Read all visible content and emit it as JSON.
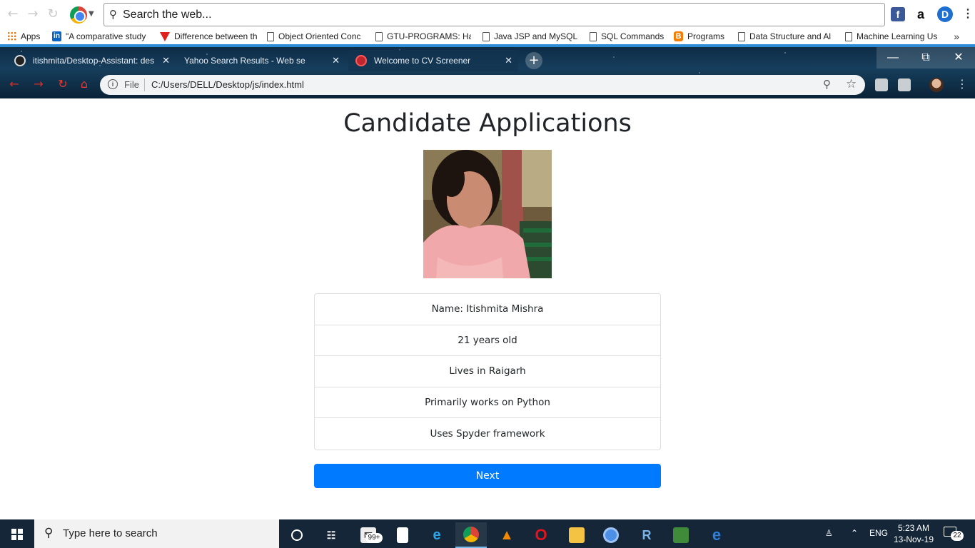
{
  "top_toolbar": {
    "search_placeholder": "Search the web..."
  },
  "bookmarks": {
    "items": [
      {
        "label": "Apps",
        "icon": "apps-grid-icon"
      },
      {
        "label": "\"A comparative study",
        "icon": "linkedin-icon"
      },
      {
        "label": "Difference between th",
        "icon": "vivaldi-icon"
      },
      {
        "label": "Object Oriented Conc",
        "icon": "doc-lock-icon"
      },
      {
        "label": "GTU-PROGRAMS: Ha",
        "icon": "page-icon"
      },
      {
        "label": "Java JSP and MySQL",
        "icon": "page-icon"
      },
      {
        "label": "SQL Commands",
        "icon": "page-icon"
      },
      {
        "label": "Programs",
        "icon": "blogger-icon"
      },
      {
        "label": "Data Structure and Al",
        "icon": "page-icon"
      },
      {
        "label": "Machine Learning Us",
        "icon": "page-icon"
      }
    ],
    "more": "»"
  },
  "tabs": [
    {
      "title": "itishmita/Desktop-Assistant: desk",
      "icon": "github-icon"
    },
    {
      "title": "Yahoo Search Results - Web search",
      "icon": ""
    },
    {
      "title": "Welcome to CV Screener",
      "icon": "cv-screener-icon",
      "active": true
    }
  ],
  "address_bar": {
    "scheme": "File",
    "url": "C:/Users/DELL/Desktop/js/index.html"
  },
  "page": {
    "title": "Candidate Applications",
    "details": [
      "Name: Itishmita Mishra",
      "21 years old",
      "Lives in Raigarh",
      "Primarily works on Python",
      "Uses Spyder framework"
    ],
    "next_label": "Next"
  },
  "taskbar": {
    "search_placeholder": "Type here to search",
    "mail_badge": "99+",
    "lang": "ENG",
    "time": "5:23 AM",
    "date": "13-Nov-19",
    "notifications": "22"
  },
  "colors": {
    "primary": "#007bff",
    "taskbar": "#142638",
    "frame_accent": "#2e8bd6"
  }
}
